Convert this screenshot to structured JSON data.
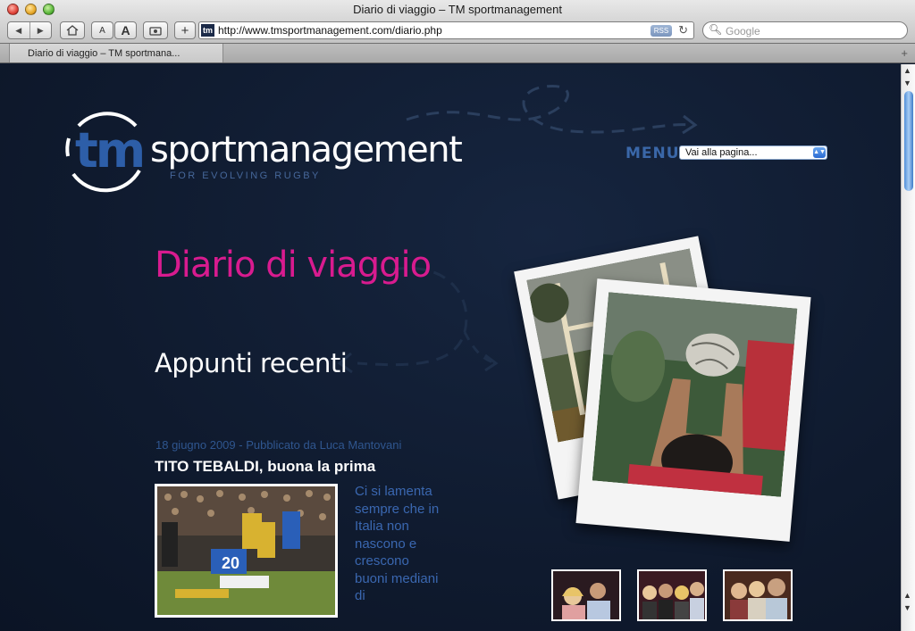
{
  "browser": {
    "window_title": "Diario di viaggio – TM sportmanagement",
    "url": "http://www.tmsportmanagement.com/diario.php",
    "favicon_text": "tm",
    "rss_label": "RSS",
    "search_placeholder": "Google",
    "tab_label": "Diario di viaggio – TM sportmana...",
    "text_small_label": "A",
    "text_large_label": "A"
  },
  "site": {
    "logo_tm": "tm",
    "logo_word": "sportmanagement",
    "logo_tagline": "FOR EVOLVING RUGBY",
    "menu_label": "MENU :",
    "menu_select_value": "Vai alla pagina..."
  },
  "main": {
    "title": "Diario di viaggio",
    "subtitle": "Appunti recenti",
    "post": {
      "meta": "18 giugno 2009 - Pubblicato da Luca Mantovani",
      "title": "TITO TEBALDI, buona la prima",
      "excerpt": "Ci si lamenta sempre che in Italia non nascono e crescono buoni mediani di",
      "player_number": "20"
    }
  },
  "colors": {
    "page_bg": "#0f1a2e",
    "accent_pink": "#d81b8f",
    "accent_blue": "#3a67a8"
  }
}
